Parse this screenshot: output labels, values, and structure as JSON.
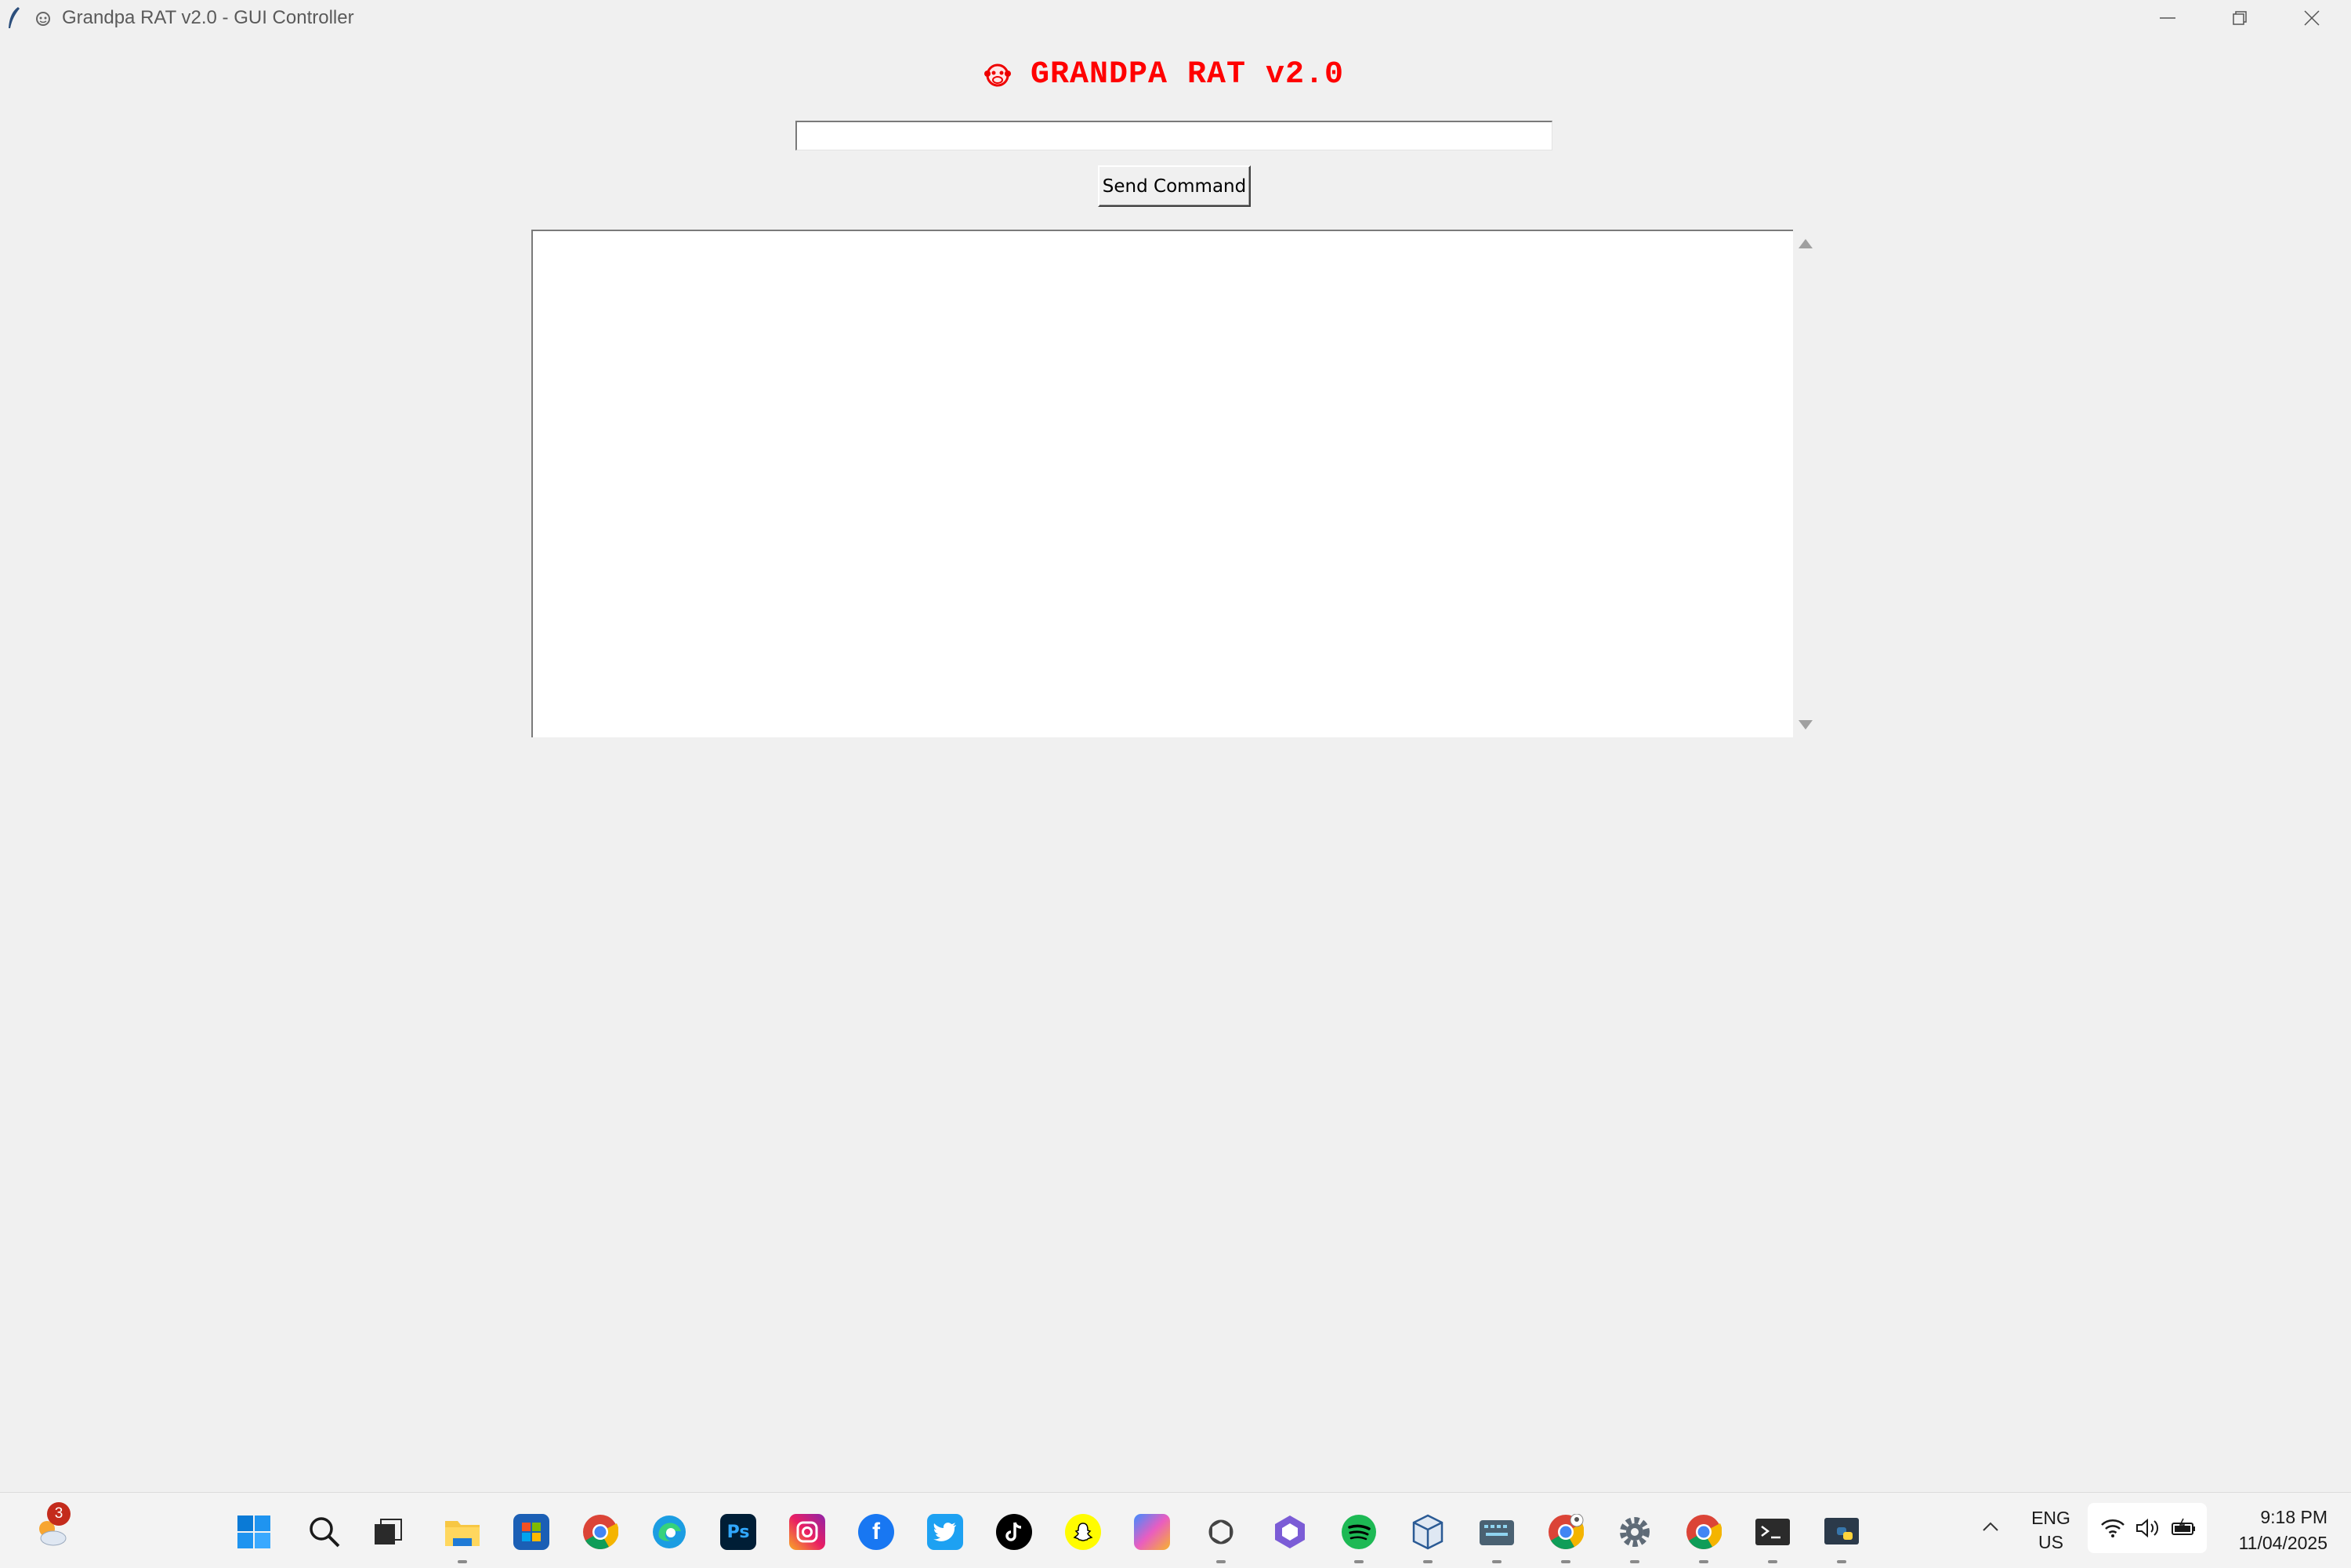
{
  "window": {
    "title": "Grandpa RAT v2.0 - GUI Controller",
    "controls": [
      "minimize",
      "restore",
      "close"
    ]
  },
  "header": {
    "icon": "monkey-face-icon",
    "title": "GRANDPA RAT v2.0",
    "title_color": "#ff0000"
  },
  "command": {
    "value": "",
    "placeholder": ""
  },
  "send_button": {
    "label": "Send Command"
  },
  "output": {
    "text": ""
  },
  "taskbar": {
    "weather_badge": "3",
    "apps": [
      "weather",
      "start",
      "search",
      "task-view",
      "file-explorer",
      "microsoft-store",
      "chrome",
      "edge",
      "photoshop",
      "instagram",
      "facebook",
      "twitter",
      "tiktok",
      "snapchat",
      "copilot",
      "chatgpt",
      "office",
      "spotify",
      "virtualbox",
      "keyboard-app",
      "chrome-profile",
      "settings",
      "chrome-2",
      "terminal",
      "python"
    ],
    "language": "ENG",
    "region": "US",
    "time": "9:18 PM",
    "date": "11/04/2025"
  }
}
